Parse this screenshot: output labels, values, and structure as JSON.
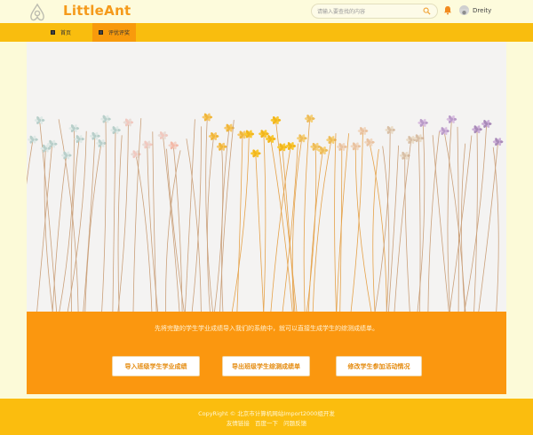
{
  "header": {
    "logo_text": "LittleAnt",
    "search_placeholder": "请输入要查找的内容",
    "user_name": "Dreity"
  },
  "nav": {
    "items": [
      {
        "label": "首页"
      },
      {
        "label": "评优评奖"
      }
    ]
  },
  "panel": {
    "description": "先将完整的学生学业成绩导入我们的系统中，就可以直接生成学生的综测成绩单。",
    "buttons": [
      {
        "label": "导入班级学生学业成绩"
      },
      {
        "label": "导出班级学生综测成绩单"
      },
      {
        "label": "修改学生参加活动情况"
      }
    ]
  },
  "footer": {
    "copyright": "CopyRight © 北京市计算机网站Import2000组开发",
    "links": [
      "友情链接",
      "百度一下",
      "问题反馈"
    ]
  },
  "colors": {
    "accent": "#f59a1a",
    "nav_bg": "#f9bd0e",
    "nav_active": "#f89a0c",
    "panel_bg": "#fb970f",
    "page_bg": "#fcfad8"
  }
}
